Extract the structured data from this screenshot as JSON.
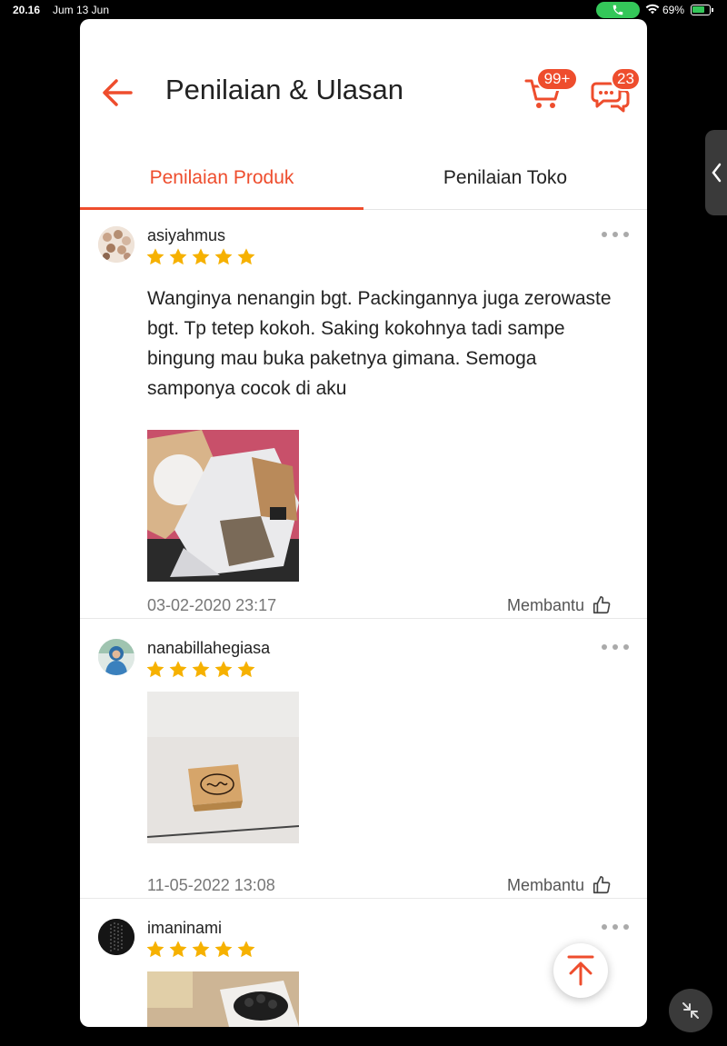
{
  "status_bar": {
    "time": "20.16",
    "date": "Jum 13 Jun",
    "battery": "69%"
  },
  "header": {
    "title": "Penilaian & Ulasan",
    "cart_badge": "99+",
    "chat_badge": "23"
  },
  "tabs": [
    {
      "label": "Penilaian Produk",
      "active": true
    },
    {
      "label": "Penilaian Toko",
      "active": false
    }
  ],
  "reviews": [
    {
      "username": "asiyahmus",
      "rating": 5,
      "text": "Wanginya nenangin bgt. Packingannya juga zerowaste bgt. Tp tetep kokoh. Saking kokohnya tadi sampe bingung mau buka paketnya gimana. Semoga samponya cocok di aku",
      "date": "03-02-2020 23:17",
      "helpful_label": "Membantu"
    },
    {
      "username": "nanabillahegiasa",
      "rating": 5,
      "text": "",
      "date": "11-05-2022 13:08",
      "helpful_label": "Membantu"
    },
    {
      "username": "imaninami",
      "rating": 5,
      "text": "",
      "date": "",
      "helpful_label": ""
    }
  ],
  "colors": {
    "accent": "#ee4d2d",
    "star": "#f6b100"
  },
  "icons": [
    "back-arrow-icon",
    "cart-icon",
    "chat-icon",
    "more-icon",
    "thumbs-up-icon",
    "arrow-up-icon"
  ]
}
